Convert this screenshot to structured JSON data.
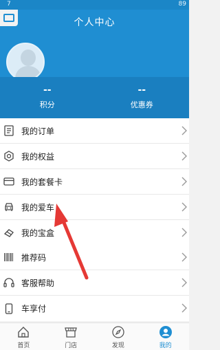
{
  "status_bar": {
    "time": "7",
    "right_text": "89"
  },
  "header": {
    "title": "个人中心"
  },
  "stats": [
    {
      "value": "--",
      "label": "积分"
    },
    {
      "value": "--",
      "label": "优惠券"
    }
  ],
  "menu_group_1": [
    {
      "icon": "document-icon",
      "label": "我的订单"
    },
    {
      "icon": "badge-icon",
      "label": "我的权益"
    },
    {
      "icon": "card-icon",
      "label": "我的套餐卡"
    },
    {
      "icon": "car-icon",
      "label": "我的爱车"
    },
    {
      "icon": "gem-icon",
      "label": "我的宝盒"
    }
  ],
  "menu_group_2": [
    {
      "icon": "barcode-icon",
      "label": "推荐码"
    },
    {
      "icon": "headset-icon",
      "label": "客服帮助"
    },
    {
      "icon": "phone-icon",
      "label": "车享付"
    }
  ],
  "tabs": [
    {
      "icon": "home-icon",
      "label": "首页",
      "active": false
    },
    {
      "icon": "store-icon",
      "label": "门店",
      "active": false
    },
    {
      "icon": "compass-icon",
      "label": "发现",
      "active": false
    },
    {
      "icon": "user-icon",
      "label": "我的",
      "active": true
    }
  ],
  "colors": {
    "header_blue": "#1f8ed2",
    "stats_blue": "#1a7fc0",
    "arrow_red": "#e53935"
  }
}
